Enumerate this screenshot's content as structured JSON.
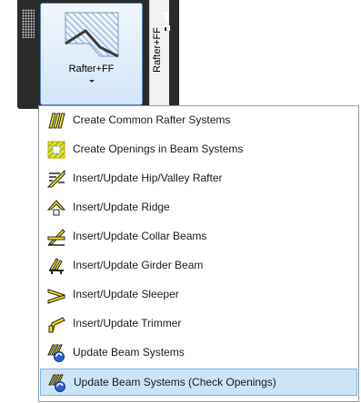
{
  "ribbon": {
    "button_label": "Rafter+FF",
    "side_tab_label": "Rafter+FF"
  },
  "menu": {
    "items": [
      {
        "label": "Create Common Rafter Systems",
        "icon": "common-rafter-systems-icon"
      },
      {
        "label": "Create Openings in Beam Systems",
        "icon": "beam-openings-icon"
      },
      {
        "label": "Insert/Update Hip/Valley Rafter",
        "icon": "hip-valley-rafter-icon"
      },
      {
        "label": "Insert/Update Ridge",
        "icon": "ridge-icon"
      },
      {
        "label": "Insert/Update Collar Beams",
        "icon": "collar-beams-icon"
      },
      {
        "label": "Insert/Update Girder Beam",
        "icon": "girder-beam-icon"
      },
      {
        "label": "Insert/Update Sleeper",
        "icon": "sleeper-icon"
      },
      {
        "label": "Insert/Update Trimmer",
        "icon": "trimmer-icon"
      },
      {
        "label": "Update Beam Systems",
        "icon": "update-beam-systems-icon"
      },
      {
        "label": "Update Beam Systems (Check Openings)",
        "icon": "update-beam-systems-check-icon"
      }
    ],
    "selected_index": 9
  },
  "colors": {
    "panel_bg": "#2b2b2b",
    "icon_yellow": "#f5e400",
    "icon_blue": "#2a5fd1",
    "selection_bg": "#cde4f7",
    "selection_border": "#77b5e8"
  }
}
